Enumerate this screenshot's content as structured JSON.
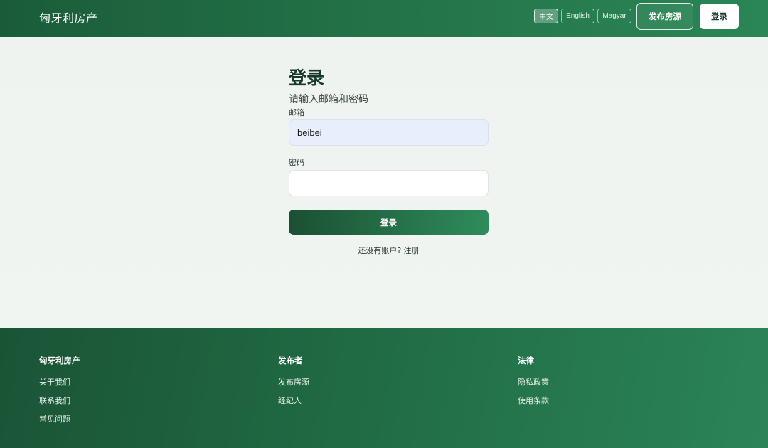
{
  "header": {
    "brand": "匈牙利房产",
    "languages": [
      {
        "label": "中文",
        "active": true
      },
      {
        "label": "English",
        "active": false
      },
      {
        "label": "Magyar",
        "active": false
      }
    ],
    "publish_label": "发布房源",
    "login_label": "登录"
  },
  "login_form": {
    "title": "登录",
    "subtitle": "请输入邮箱和密码",
    "email_label": "邮箱",
    "email_value": "beibei",
    "password_label": "密码",
    "password_value": "",
    "submit_label": "登录",
    "no_account_text": "还没有账户?",
    "register_link": "注册"
  },
  "footer": {
    "columns": [
      {
        "heading": "匈牙利房产",
        "links": [
          "关于我们",
          "联系我们",
          "常见问题"
        ]
      },
      {
        "heading": "发布者",
        "links": [
          "发布房源",
          "经纪人"
        ]
      },
      {
        "heading": "法律",
        "links": [
          "隐私政策",
          "使用条款"
        ]
      }
    ]
  },
  "colors": {
    "header_bg": "#1a5c3a",
    "accent_green": "#2a8656",
    "email_field_bg": "#e8effc",
    "page_bg": "#f0f4f1"
  }
}
